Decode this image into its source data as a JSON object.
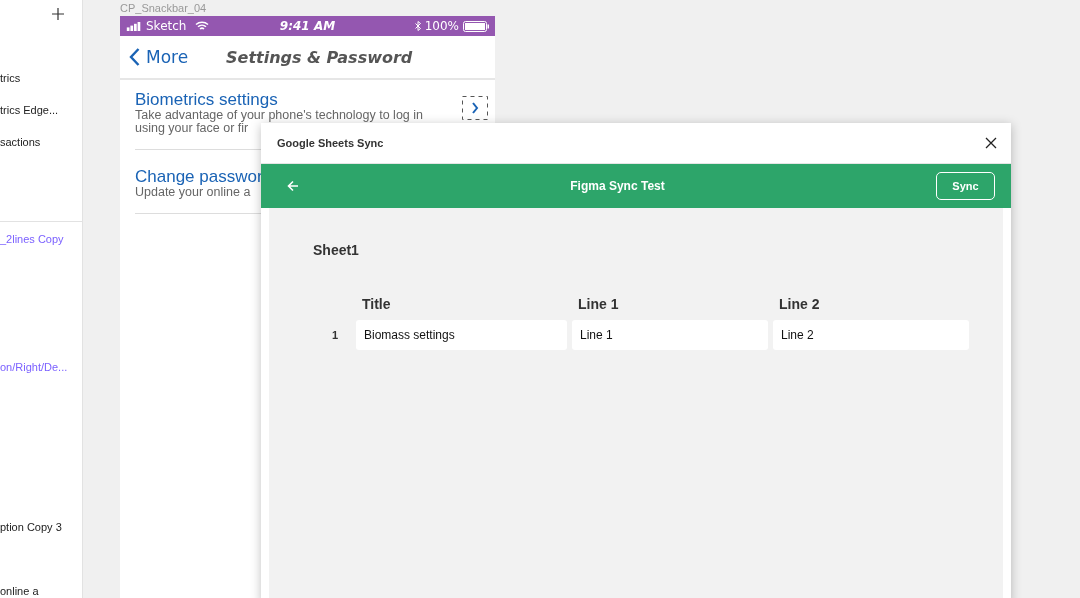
{
  "layers_panel": {
    "items": [
      {
        "label": "trics",
        "kind": "layer"
      },
      {
        "label": "trics Edge...",
        "kind": "layer"
      },
      {
        "label": "sactions",
        "kind": "layer"
      },
      {
        "label": "_2lines Copy",
        "kind": "component"
      },
      {
        "label": "on/Right/De...",
        "kind": "component"
      },
      {
        "label": "ption Copy 3",
        "kind": "layer"
      },
      {
        "label": "online a",
        "kind": "layer"
      }
    ]
  },
  "frame": {
    "name": "CP_Snackbar_04",
    "status_bar": {
      "carrier": "Sketch",
      "time": "9:41 AM",
      "battery": "100%"
    },
    "nav": {
      "back": "More",
      "title": "Settings & Password"
    },
    "items": [
      {
        "title": "Biometrics settings",
        "description": [
          "Take advantage of your phone's technology to log in",
          "using your face or fir"
        ]
      },
      {
        "title": "Change passwor",
        "description": [
          "Update your online a"
        ]
      }
    ]
  },
  "plugin": {
    "window_title": "Google Sheets Sync",
    "header_title": "Figma Sync Test",
    "sync_button": "Sync",
    "sheet_name": "Sheet1",
    "table": {
      "columns": [
        "Title",
        "Line 1",
        "Line 2"
      ],
      "rows": [
        {
          "index": "1",
          "cells": [
            "Biomass settings",
            "Line 1",
            "Line 2"
          ]
        }
      ]
    }
  }
}
